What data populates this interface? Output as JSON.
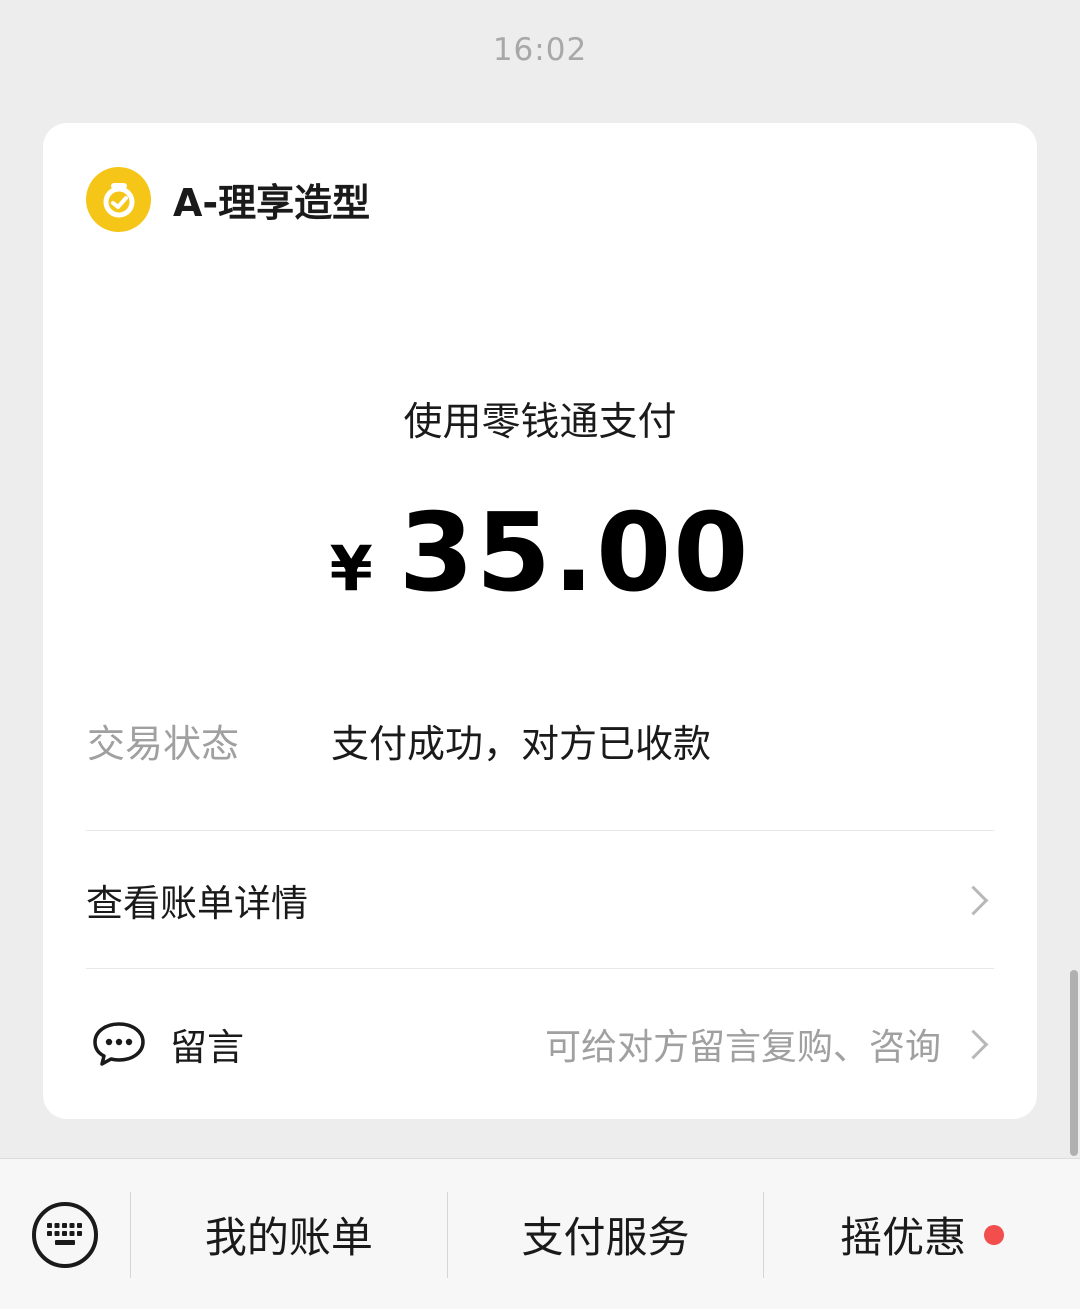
{
  "chat": {
    "timestamp": "16:02"
  },
  "payment_card": {
    "merchant_name": "A-理享造型",
    "pay_method": "使用零钱通支付",
    "currency_symbol": "¥",
    "amount": "35.00",
    "status_label": "交易状态",
    "status_value": "支付成功，对方已收款",
    "detail_link": "查看账单详情",
    "message_label": "留言",
    "message_hint": "可给对方留言复购、咨询",
    "logo_color": "#f5c518"
  },
  "bottom_menu": {
    "items": [
      {
        "label": "我的账单"
      },
      {
        "label": "支付服务"
      },
      {
        "label": "摇优惠",
        "has_dot": true,
        "dot_color": "#f24e4e"
      }
    ]
  }
}
